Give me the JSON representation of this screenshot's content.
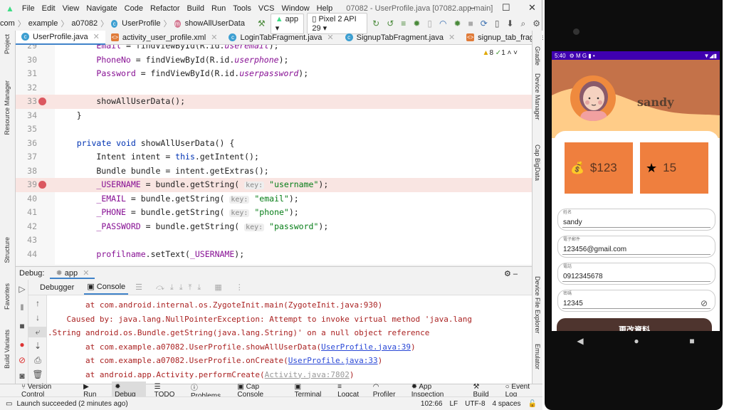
{
  "window": {
    "title": "07082 - UserProfile.java [07082.app.main]",
    "menu": [
      "File",
      "Edit",
      "View",
      "Navigate",
      "Code",
      "Refactor",
      "Build",
      "Run",
      "Tools",
      "VCS",
      "Window",
      "Help"
    ],
    "minimize": "–",
    "maximize": "☐",
    "close": "✕"
  },
  "navbar": {
    "breadcrumbs": [
      "com",
      "example",
      "a07082",
      "UserProfile",
      "showAllUserData"
    ],
    "run_config": "app",
    "device": "Pixel 2 API 29"
  },
  "tabs": [
    "UserProfile.java",
    "activity_user_profile.xml",
    "LoginTabFragment.java",
    "SignupTabFragment.java",
    "signup_tab_fragment.xml"
  ],
  "left_strip": [
    "Project",
    "Resource Manager",
    "Structure",
    "Favorites",
    "Build Variants"
  ],
  "right_strip": [
    "Gradle",
    "Device Manager",
    "Cap BigData",
    "Device File Explorer",
    "Emulator"
  ],
  "inspections": {
    "warnings": "8",
    "ok": "1"
  },
  "code": [
    {
      "n": "29",
      "bp": false,
      "t": [
        [
          "        "
        ],
        [
          "Email",
          "fld"
        ],
        [
          " = findViewById(R.id."
        ],
        [
          "useremail",
          "it"
        ],
        [
          ");"
        ]
      ]
    },
    {
      "n": "30",
      "bp": false,
      "t": [
        [
          "        "
        ],
        [
          "PhoneNo",
          "fld"
        ],
        [
          " = findViewById(R.id."
        ],
        [
          "userphone",
          "it"
        ],
        [
          ");"
        ]
      ]
    },
    {
      "n": "31",
      "bp": false,
      "t": [
        [
          "        "
        ],
        [
          "Password",
          "fld"
        ],
        [
          " = findViewById(R.id."
        ],
        [
          "userpassword",
          "it"
        ],
        [
          ");"
        ]
      ]
    },
    {
      "n": "32",
      "bp": false,
      "t": []
    },
    {
      "n": "33",
      "bp": true,
      "t": [
        [
          "        showAllUserData();"
        ]
      ]
    },
    {
      "n": "34",
      "bp": false,
      "t": [
        [
          "    }"
        ]
      ]
    },
    {
      "n": "35",
      "bp": false,
      "t": []
    },
    {
      "n": "36",
      "bp": false,
      "t": [
        [
          "    "
        ],
        [
          "private void",
          "kw"
        ],
        [
          " showAllUserData() {"
        ]
      ]
    },
    {
      "n": "37",
      "bp": false,
      "t": [
        [
          "        Intent intent = "
        ],
        [
          "this",
          "kw"
        ],
        [
          ".getIntent();"
        ]
      ]
    },
    {
      "n": "38",
      "bp": false,
      "t": [
        [
          "        Bundle bundle = intent.getExtras();"
        ]
      ]
    },
    {
      "n": "39",
      "bp": true,
      "t": [
        [
          "        "
        ],
        [
          "_USERNAME",
          "fld"
        ],
        [
          " = bundle.getString( "
        ],
        [
          "key:",
          "hint"
        ],
        [
          " "
        ],
        [
          "\"username\"",
          "str"
        ],
        [
          ");"
        ]
      ]
    },
    {
      "n": "40",
      "bp": false,
      "t": [
        [
          "        "
        ],
        [
          "_EMAIL",
          "fld"
        ],
        [
          " = bundle.getString( "
        ],
        [
          "key:",
          "hint"
        ],
        [
          " "
        ],
        [
          "\"email\"",
          "str"
        ],
        [
          ");"
        ]
      ]
    },
    {
      "n": "41",
      "bp": false,
      "t": [
        [
          "        "
        ],
        [
          "_PHONE",
          "fld"
        ],
        [
          " = bundle.getString( "
        ],
        [
          "key:",
          "hint"
        ],
        [
          " "
        ],
        [
          "\"phone\"",
          "str"
        ],
        [
          ");"
        ]
      ]
    },
    {
      "n": "42",
      "bp": false,
      "t": [
        [
          "        "
        ],
        [
          "_PASSWORD",
          "fld"
        ],
        [
          " = bundle.getString( "
        ],
        [
          "key:",
          "hint"
        ],
        [
          " "
        ],
        [
          "\"password\"",
          "str"
        ],
        [
          ");"
        ]
      ]
    },
    {
      "n": "43",
      "bp": false,
      "t": []
    },
    {
      "n": "44",
      "bp": false,
      "t": [
        [
          "        "
        ],
        [
          "profilname",
          "fld"
        ],
        [
          ".setText("
        ],
        [
          "_USERNAME",
          "fld"
        ],
        [
          ");"
        ]
      ]
    }
  ],
  "debug": {
    "label": "Debug:",
    "session": "app",
    "tabs": [
      "Debugger",
      "Console"
    ]
  },
  "console": [
    {
      "t": [
        [
          "        at com.android.internal.os.ZygoteInit.main(ZygoteInit.java:930)"
        ]
      ]
    },
    {
      "t": [
        [
          "    Caused by: java.lang.NullPointerException: Attempt to invoke virtual method 'java.lang"
        ]
      ]
    },
    {
      "t": [
        [
          ".String android.os.Bundle.getString(java.lang.String)' on a null object reference"
        ]
      ]
    },
    {
      "t": [
        [
          "        at com.example.a07082.UserProfile.showAllUserData("
        ],
        [
          "UserProfile.java:39",
          "lnk"
        ],
        [
          ")"
        ]
      ]
    },
    {
      "t": [
        [
          "        at com.example.a07082.UserProfile.onCreate("
        ],
        [
          "UserProfile.java:33",
          "lnk"
        ],
        [
          ")"
        ]
      ]
    },
    {
      "t": [
        [
          "        at android.app.Activity.performCreate("
        ],
        [
          "Activity.java:7802",
          "gry"
        ],
        [
          ")"
        ]
      ]
    }
  ],
  "bottom_tabs": [
    "Version Control",
    "Run",
    "Debug",
    "TODO",
    "Problems",
    "Cap Console",
    "Terminal",
    "Logcat",
    "Profiler",
    "App Inspection",
    "Build",
    "Event Log"
  ],
  "status": {
    "message": "Launch succeeded (2 minutes ago)",
    "position": "102:66",
    "line_sep": "LF",
    "encoding": "UTF-8",
    "indent": "4 spaces"
  },
  "phone": {
    "time": "5:40",
    "username": "sandy",
    "money": "$123",
    "stars": "15",
    "fields": [
      {
        "label": "姓名",
        "value": "sandy"
      },
      {
        "label": "電子郵件",
        "value": "123456@gmail.com"
      },
      {
        "label": "電話",
        "value": "0912345678"
      },
      {
        "label": "密碼",
        "value": "12345"
      }
    ],
    "button": "更改資料",
    "colors": {
      "status_bar": "#3f00b0",
      "header": "#c47249",
      "wave": "#ffcc88",
      "stat": "#ef7f3e",
      "button": "#4e342e"
    }
  }
}
